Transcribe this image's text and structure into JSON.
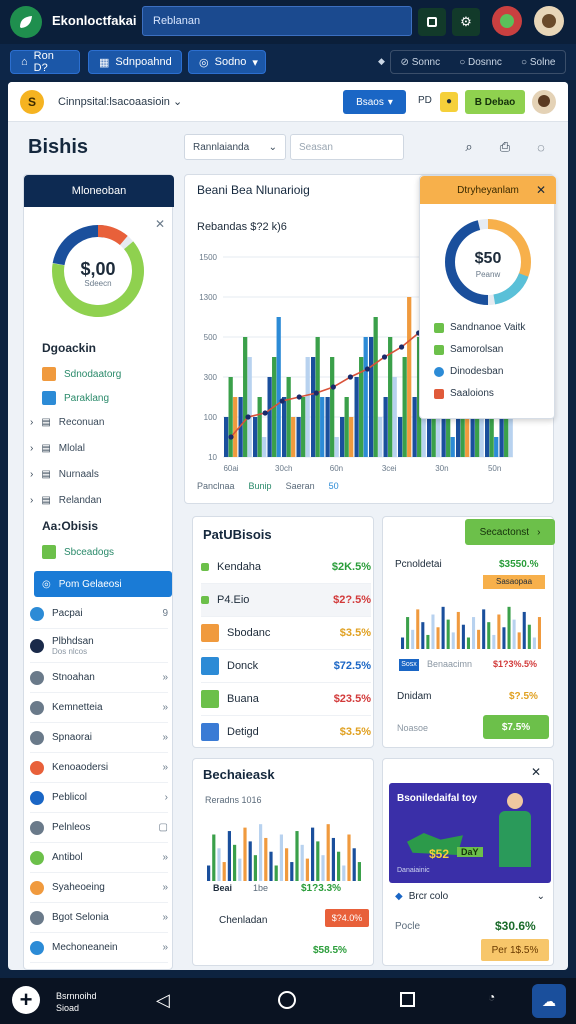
{
  "topbar": {
    "brand": "Ekonloctfakai",
    "search": "Reblanan"
  },
  "toolbar": {
    "pill1": "Ron D?",
    "pill2": "Sdnpoahnd",
    "pill3": "Sodno",
    "right": [
      "Sonnc",
      "Dosnnc",
      "Solne"
    ]
  },
  "app": {
    "workspace": "Cinnpsital:lsacoaasioin",
    "btn_blue": "Bsaos",
    "pr_label": "PD",
    "btn_green": "B Debao",
    "page_title": "Bishis",
    "filter": "Rannlaianda",
    "search_placeholder": "Seasan"
  },
  "sidebar": {
    "header": "Mloneoban",
    "donut_value": "$,00",
    "donut_sub": "Sdeecn",
    "section1": "Dgoackin",
    "nav1": [
      {
        "label": "Sdnodaatorg",
        "color": "#f09a3e"
      },
      {
        "label": "Paraklang",
        "color": "#2c8bd6"
      }
    ],
    "nav2": [
      "Reconuan",
      "Mlolal",
      "Nurnaals",
      "Relandan"
    ],
    "section2": "Aa:Obisis",
    "nav3": {
      "label": "Sbceadogs",
      "color": "#6cc04a"
    },
    "active": "Pom Gelaeosi",
    "items": [
      {
        "label": "Pacpai",
        "chev": "9"
      },
      {
        "label": "Plbhdsan",
        "sub": "Dos nlcos",
        "chev": ""
      },
      {
        "label": "Stnoahan",
        "chev": "»"
      },
      {
        "label": "Kemnetteia",
        "chev": "»"
      },
      {
        "label": "Spnaorai",
        "chev": "»"
      },
      {
        "label": "Kenoaodersi",
        "chev": "»"
      },
      {
        "label": "Peblicol",
        "chev": "›"
      },
      {
        "label": "Pelnleos",
        "chev": "▢"
      },
      {
        "label": "Antibol",
        "chev": "»"
      },
      {
        "label": "Syaheoeing",
        "chev": "»"
      },
      {
        "label": "Bgot Selonia",
        "chev": "»"
      },
      {
        "label": "Mechoneanein",
        "chev": "»"
      }
    ]
  },
  "main_chart": {
    "title": "Beani Bea Nlunarioig",
    "subtitle": "Rebandas $?2 k)6",
    "legend": [
      "Panclnaa",
      "Bunip",
      "Saeran",
      "50"
    ],
    "popup": {
      "header": "Dtryheyanlam",
      "donut_value": "$50",
      "donut_sub": "Peanw",
      "items": [
        {
          "label": "Sandnanoe Vaitk",
          "color": "#6cc04a"
        },
        {
          "label": "Samorolsan",
          "color": "#6cc04a"
        },
        {
          "label": "Dinodesban",
          "color": "#2c8bd6"
        },
        {
          "label": "Saaloions",
          "color": "#e05a3a"
        }
      ]
    }
  },
  "chart_data": {
    "type": "bar",
    "title": "Beani Bea Nlunarioig",
    "ylabel": "",
    "xlabel": "",
    "y_ticks": [
      "10",
      "100",
      "300",
      "500",
      "1300",
      "1500"
    ],
    "x_ticks": [
      "60ai",
      "30ch",
      "60n",
      "3cei",
      "30n",
      "50n"
    ],
    "series": [
      {
        "values": [
          2,
          3,
          2,
          4,
          3,
          2,
          5,
          3,
          2,
          4,
          6,
          3,
          2,
          3,
          4,
          2,
          3,
          2,
          3,
          2
        ]
      },
      {
        "values": [
          4,
          6,
          3,
          5,
          4,
          3,
          6,
          5,
          3,
          5,
          7,
          6,
          5,
          6,
          7,
          5,
          4,
          3,
          4,
          3
        ]
      },
      {
        "values": [
          3,
          5,
          1,
          7,
          2,
          5,
          3,
          1,
          2,
          6,
          2,
          4,
          8,
          3,
          2,
          1,
          3,
          2,
          1,
          2
        ]
      }
    ],
    "line": [
      1,
      2,
      2.2,
      2.8,
      3,
      3.2,
      3.5,
      4,
      4.4,
      5,
      5.5,
      6.2,
      7
    ]
  },
  "profits": {
    "title": "PatUBisois",
    "rows": [
      {
        "label": "Kendaha",
        "value": "$2K.5%",
        "color": "#2a9d3a",
        "icon": "#6cc04a"
      },
      {
        "label": "P4.Eio",
        "value": "$2?.5%",
        "color": "#d23a3a",
        "icon": "#6cc04a"
      },
      {
        "label": "Sbodanc",
        "value": "$3.5%",
        "color": "#e0a020",
        "icon": "#f09a3e"
      },
      {
        "label": "Donck",
        "value": "$72.5%",
        "color": "#1a66c5",
        "icon": "#2c8bd6"
      },
      {
        "label": "Buana",
        "value": "$23.5%",
        "color": "#d23a3a",
        "icon": "#6cc04a"
      },
      {
        "label": "Detigd",
        "value": "$3.5%",
        "color": "#e0a020",
        "icon": "#3a7bd5"
      }
    ]
  },
  "right_card": {
    "button": "Secactonst",
    "title": "Pcnoldetai",
    "value": "$3550.%",
    "badge": "Sasaopaa",
    "tag": "Sosx",
    "tag_text": "Benaacimn",
    "tag_value": "$1?3%.5%",
    "row2_label": "Dnidam",
    "row2_value": "$?.5%",
    "row3_label": "Noasoe",
    "row3_value": "$7.5%"
  },
  "bottom_left": {
    "title": "Bechaieask",
    "subtitle": "Reradns 1016",
    "label1": "Beai",
    "label2": "1be",
    "val1": "$1?3.3%",
    "row1_label": "Chenladan",
    "row1_value": "$?4.0%",
    "row2_label": "",
    "row2_value": "$58.5%"
  },
  "promo": {
    "title": "Bsoniledaifal toy",
    "price": "$52",
    "badge": "DaY",
    "caption": "Danaiainic",
    "select": "Brcr colo",
    "row_label": "Pocle",
    "row_value": "$30.6%",
    "button": "Per 1$.5%"
  },
  "bottombar": {
    "line1": "Bsrnnoihd",
    "line2": "Sioad"
  }
}
